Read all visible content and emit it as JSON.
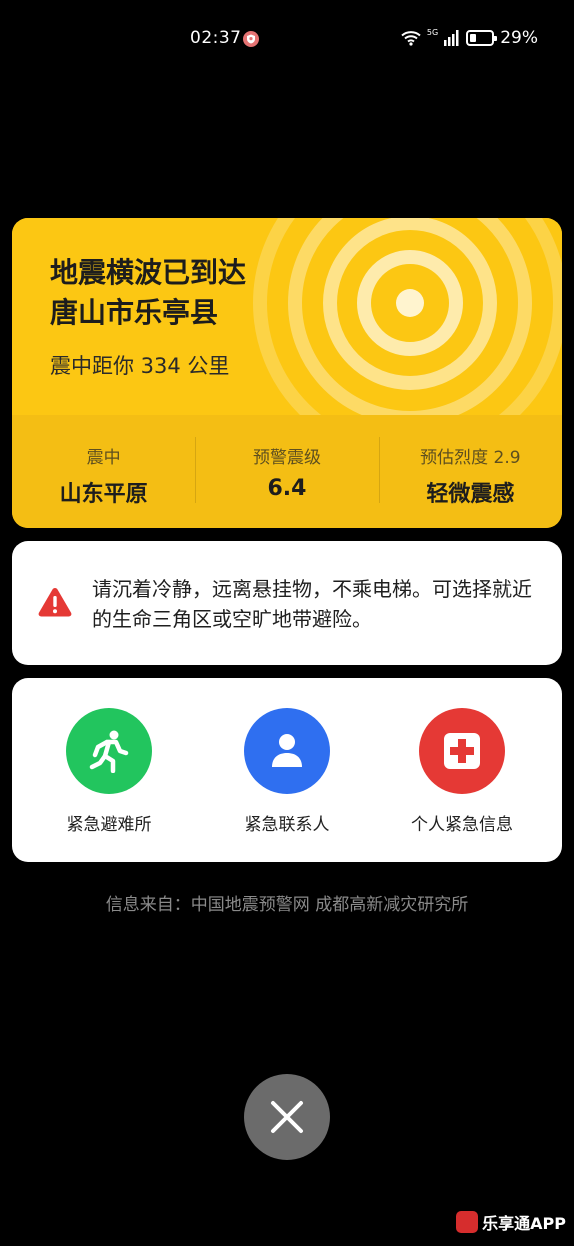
{
  "status_bar": {
    "time": "02:37",
    "network": "5G",
    "battery": "29%",
    "battery_level": 0.29
  },
  "quake": {
    "title_line1": "地震横波已到达",
    "title_line2": "唐山市乐亭县",
    "distance": "震中距你 334 公里",
    "stats": [
      {
        "label": "震中",
        "value": "山东平原"
      },
      {
        "label": "预警震级",
        "value": "6.4"
      },
      {
        "label": "预估烈度 2.9",
        "value": "轻微震感"
      }
    ],
    "color_top": "#fcc713",
    "color_bottom": "#f4be14"
  },
  "advice": {
    "text": "请沉着冷静，远离悬挂物，不乘电梯。可选择就近的生命三角区或空旷地带避险。",
    "icon": "warning-icon",
    "icon_color": "#e53935"
  },
  "actions": [
    {
      "label": "紧急避难所",
      "icon": "running-person-icon",
      "color": "#22c55e"
    },
    {
      "label": "紧急联系人",
      "icon": "person-icon",
      "color": "#2f6ff0"
    },
    {
      "label": "个人紧急信息",
      "icon": "medical-cross-icon",
      "color": "#e53935"
    }
  ],
  "source": "信息来自：中国地震预警网 成都高新减灾研究所",
  "watermark": "乐享通APP"
}
